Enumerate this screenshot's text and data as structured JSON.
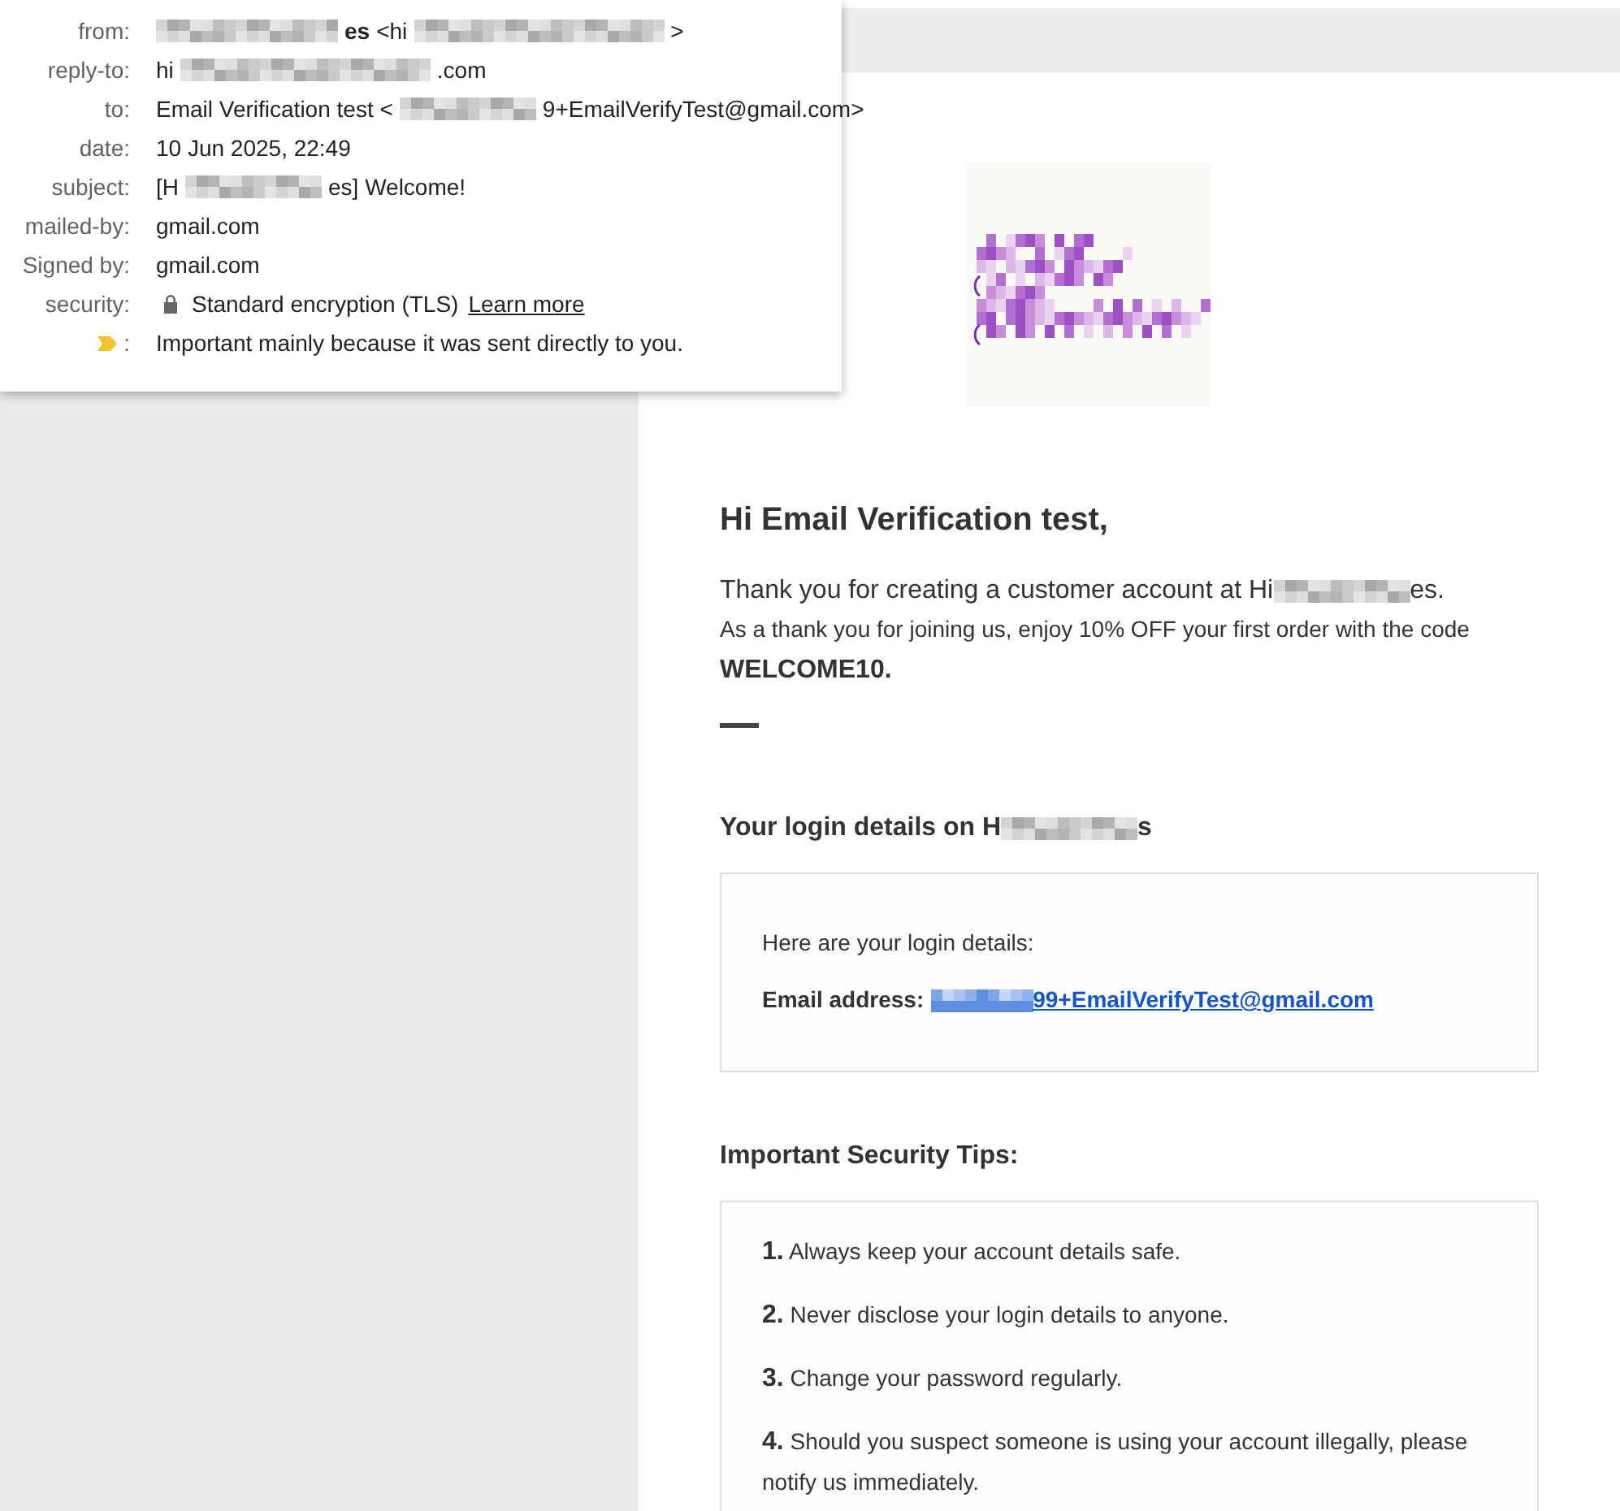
{
  "header_details": {
    "rows": [
      {
        "kind": "text",
        "label": "from:",
        "parts": [
          {
            "kind": "long"
          },
          {
            "kind": "text",
            "text": "es",
            "bold": true
          },
          {
            "kind": "text",
            "text": "<hi",
            "bold": false
          },
          {
            "kind": "wide"
          },
          {
            "kind": "text",
            "text": ">",
            "bold": false
          }
        ]
      },
      {
        "kind": "text",
        "label": "reply-to:",
        "parts": [
          {
            "kind": "text",
            "text": "hi",
            "bold": false
          },
          {
            "kind": "wide"
          },
          {
            "kind": "text",
            "text": ".com",
            "bold": false
          }
        ]
      },
      {
        "kind": "text",
        "label": "to:",
        "parts": [
          {
            "kind": "text",
            "text": "Email Verification test <",
            "bold": false
          },
          {
            "kind": "medium"
          },
          {
            "kind": "text",
            "text": "9+EmailVerifyTest@gmail.com>",
            "bold": false
          }
        ]
      },
      {
        "kind": "text",
        "label": "date:",
        "parts": [
          {
            "kind": "text",
            "text": "10 Jun 2025, 22:49",
            "bold": false
          }
        ]
      },
      {
        "kind": "text",
        "label": "subject:",
        "parts": [
          {
            "kind": "text",
            "text": "[H",
            "bold": false
          },
          {
            "kind": "medium"
          },
          {
            "kind": "text",
            "text": "es] Welcome!",
            "bold": false
          }
        ]
      },
      {
        "kind": "text",
        "label": "mailed-by:",
        "parts": [
          {
            "kind": "text",
            "text": "gmail.com",
            "bold": false
          }
        ]
      },
      {
        "kind": "text",
        "label": "Signed by:",
        "parts": [
          {
            "kind": "text",
            "text": "gmail.com",
            "bold": false
          }
        ]
      },
      {
        "kind": "security",
        "label": "security:",
        "text": "Standard encryption (TLS)",
        "link": "Learn more"
      },
      {
        "kind": "importance",
        "label": ":",
        "text": "Important mainly because it was sent directly to you."
      }
    ]
  },
  "email": {
    "greeting": "Hi Email Verification test,",
    "intro": [
      {
        "kind": "text",
        "text": "Thank you for creating a customer account at Hi"
      },
      {
        "kind": "medium"
      },
      {
        "kind": "text",
        "text": "es."
      }
    ],
    "offer": "As a thank you for joining us, enjoy 10% OFF your first order with the code",
    "code": "WELCOME10.",
    "login_heading": [
      {
        "kind": "text",
        "text": "Your login details on H"
      },
      {
        "kind": "medium"
      },
      {
        "kind": "text",
        "text": "s"
      }
    ],
    "login_box": {
      "intro": "Here are your login details:",
      "email_label": "Email address:",
      "email_link": [
        {
          "kind": "short"
        },
        {
          "kind": "text",
          "text": "99+EmailVerifyTest@gmail.com"
        }
      ]
    },
    "tips_heading": "Important Security Tips:",
    "tips": [
      {
        "text": "**1.** Always keep your account details safe."
      },
      {
        "text": "**2.** Never disclose your login details to anyone."
      },
      {
        "text": "**3.** Change your password regularly."
      },
      {
        "text": "**4.** Should you suspect someone is using your account illegally, please notify us immediately."
      }
    ]
  }
}
